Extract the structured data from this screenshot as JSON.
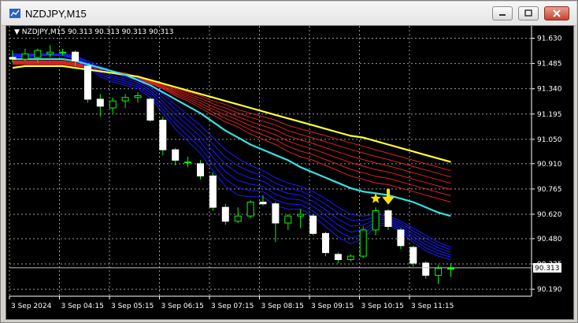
{
  "window": {
    "title": "NZDJPY,M15",
    "minimize_icon": "minimize-icon",
    "restore_icon": "restore-icon",
    "close_icon": "close-icon"
  },
  "chart_data": {
    "type": "candlestick",
    "symbol_header": "NZDJPY,M15  90.313 90.313 90.313 90.313",
    "ylim": [
      90.15,
      91.7
    ],
    "y_ticks": [
      "91.630",
      "91.485",
      "91.340",
      "91.195",
      "91.050",
      "90.910",
      "90.765",
      "90.620",
      "90.480",
      "90.335",
      "90.190"
    ],
    "y_tick_values": [
      91.63,
      91.485,
      91.34,
      91.195,
      91.05,
      90.91,
      90.765,
      90.62,
      90.48,
      90.335,
      90.19
    ],
    "x_ticks": [
      "3 Sep 2024",
      "3 Sep 04:15",
      "3 Sep 05:15",
      "3 Sep 06:15",
      "3 Sep 07:15",
      "3 Sep 08:15",
      "3 Sep 09:15",
      "3 Sep 10:15",
      "3 Sep 11:15"
    ],
    "current_price": "90.313",
    "grid": true,
    "colors": {
      "background": "#000000",
      "grid": "#9a9a9a",
      "bull_body": "#000000",
      "bull_outline": "#00ff00",
      "bear_body": "#ffffff",
      "bear_outline": "#ffffff",
      "wick": "#00ff00",
      "fast_ma": "#1a1aff",
      "cyan_ma": "#35e0e0",
      "yellow_ma": "#ffff33",
      "red_ma": "#dd2222",
      "annotation": "#ffe000"
    },
    "candles": [
      {
        "o": 91.52,
        "h": 91.56,
        "l": 91.49,
        "c": 91.51
      },
      {
        "o": 91.51,
        "h": 91.57,
        "l": 91.5,
        "c": 91.54
      },
      {
        "o": 91.52,
        "h": 91.57,
        "l": 91.49,
        "c": 91.56
      },
      {
        "o": 91.54,
        "h": 91.59,
        "l": 91.52,
        "c": 91.55
      },
      {
        "o": 91.55,
        "h": 91.57,
        "l": 91.53,
        "c": 91.55
      },
      {
        "o": 91.55,
        "h": 91.56,
        "l": 91.47,
        "c": 91.5
      },
      {
        "o": 91.47,
        "h": 91.48,
        "l": 91.26,
        "c": 91.28
      },
      {
        "o": 91.28,
        "h": 91.31,
        "l": 91.18,
        "c": 91.24
      },
      {
        "o": 91.23,
        "h": 91.29,
        "l": 91.2,
        "c": 91.27
      },
      {
        "o": 91.27,
        "h": 91.31,
        "l": 91.23,
        "c": 91.29
      },
      {
        "o": 91.29,
        "h": 91.32,
        "l": 91.26,
        "c": 91.3
      },
      {
        "o": 91.28,
        "h": 91.29,
        "l": 91.15,
        "c": 91.16
      },
      {
        "o": 91.16,
        "h": 91.18,
        "l": 90.96,
        "c": 90.99
      },
      {
        "o": 90.99,
        "h": 91.0,
        "l": 90.9,
        "c": 90.93
      },
      {
        "o": 90.92,
        "h": 90.95,
        "l": 90.89,
        "c": 90.92
      },
      {
        "o": 90.91,
        "h": 90.93,
        "l": 90.82,
        "c": 90.84
      },
      {
        "o": 90.84,
        "h": 90.86,
        "l": 90.64,
        "c": 90.66
      },
      {
        "o": 90.66,
        "h": 90.68,
        "l": 90.56,
        "c": 90.58
      },
      {
        "o": 90.58,
        "h": 90.66,
        "l": 90.57,
        "c": 90.61
      },
      {
        "o": 90.61,
        "h": 90.7,
        "l": 90.6,
        "c": 90.69
      },
      {
        "o": 90.69,
        "h": 90.73,
        "l": 90.67,
        "c": 90.68
      },
      {
        "o": 90.68,
        "h": 90.69,
        "l": 90.46,
        "c": 90.57
      },
      {
        "o": 90.57,
        "h": 90.62,
        "l": 90.53,
        "c": 90.61
      },
      {
        "o": 90.61,
        "h": 90.65,
        "l": 90.54,
        "c": 90.62
      },
      {
        "o": 90.61,
        "h": 90.62,
        "l": 90.5,
        "c": 90.51
      },
      {
        "o": 90.51,
        "h": 90.52,
        "l": 90.38,
        "c": 90.4
      },
      {
        "o": 90.39,
        "h": 90.4,
        "l": 90.34,
        "c": 90.36
      },
      {
        "o": 90.36,
        "h": 90.39,
        "l": 90.35,
        "c": 90.38
      },
      {
        "o": 90.38,
        "h": 90.55,
        "l": 90.37,
        "c": 90.53
      },
      {
        "o": 90.53,
        "h": 90.66,
        "l": 90.5,
        "c": 90.64
      },
      {
        "o": 90.64,
        "h": 90.65,
        "l": 90.53,
        "c": 90.55
      },
      {
        "o": 90.53,
        "h": 90.54,
        "l": 90.42,
        "c": 90.44
      },
      {
        "o": 90.43,
        "h": 90.44,
        "l": 90.32,
        "c": 90.34
      },
      {
        "o": 90.34,
        "h": 90.35,
        "l": 90.25,
        "c": 90.27
      },
      {
        "o": 90.27,
        "h": 90.33,
        "l": 90.22,
        "c": 90.31
      },
      {
        "o": 90.31,
        "h": 90.34,
        "l": 90.26,
        "c": 90.31
      }
    ],
    "ma_yellow": [
      91.46,
      91.47,
      91.47,
      91.47,
      91.47,
      91.46,
      91.45,
      91.44,
      91.43,
      91.42,
      91.41,
      91.39,
      91.37,
      91.35,
      91.33,
      91.31,
      91.29,
      91.27,
      91.25,
      91.23,
      91.21,
      91.19,
      91.17,
      91.15,
      91.13,
      91.11,
      91.09,
      91.07,
      91.06,
      91.04,
      91.02,
      91.0,
      90.98,
      90.96,
      90.94,
      90.92
    ],
    "ma_red_top": [
      91.48,
      91.48,
      91.48,
      91.48,
      91.48,
      91.47,
      91.46,
      91.45,
      91.44,
      91.43,
      91.41,
      91.39,
      91.37,
      91.34,
      91.32,
      91.3,
      91.27,
      91.25,
      91.22,
      91.2,
      91.18,
      91.16,
      91.13,
      91.11,
      91.09,
      91.07,
      91.05,
      91.03,
      91.01,
      90.99,
      90.97,
      90.95,
      90.93,
      90.91,
      90.89,
      90.87
    ],
    "ma_red_bottom": [
      91.5,
      91.5,
      91.5,
      91.5,
      91.5,
      91.49,
      91.47,
      91.46,
      91.44,
      91.42,
      91.4,
      91.37,
      91.34,
      91.3,
      91.27,
      91.23,
      91.19,
      91.15,
      91.12,
      91.08,
      91.05,
      91.02,
      90.98,
      90.95,
      90.93,
      90.9,
      90.87,
      90.84,
      90.82,
      90.8,
      90.79,
      90.77,
      90.75,
      90.73,
      90.71,
      90.69
    ],
    "ma_cyan": [
      91.51,
      91.51,
      91.51,
      91.51,
      91.51,
      91.5,
      91.48,
      91.46,
      91.44,
      91.42,
      91.39,
      91.36,
      91.32,
      91.28,
      91.24,
      91.2,
      91.15,
      91.1,
      91.06,
      91.02,
      90.99,
      90.96,
      90.93,
      90.89,
      90.86,
      90.83,
      90.8,
      90.77,
      90.75,
      90.74,
      90.73,
      90.71,
      90.69,
      90.66,
      90.63,
      90.61
    ],
    "ma_blue_top": [
      91.52,
      91.52,
      91.53,
      91.53,
      91.53,
      91.51,
      91.46,
      91.41,
      91.38,
      91.36,
      91.34,
      91.29,
      91.2,
      91.11,
      91.04,
      90.97,
      90.87,
      90.78,
      90.73,
      90.72,
      90.72,
      90.67,
      90.65,
      90.65,
      90.61,
      90.55,
      90.49,
      90.45,
      90.48,
      90.55,
      90.56,
      90.52,
      90.46,
      90.41,
      90.38,
      90.36
    ],
    "ma_blue_bottom": [
      91.54,
      91.54,
      91.54,
      91.54,
      91.54,
      91.53,
      91.5,
      91.47,
      91.44,
      91.42,
      91.4,
      91.36,
      91.31,
      91.25,
      91.19,
      91.13,
      91.06,
      90.99,
      90.94,
      90.9,
      90.87,
      90.83,
      90.8,
      90.78,
      90.75,
      90.71,
      90.66,
      90.62,
      90.61,
      90.62,
      90.61,
      90.58,
      90.54,
      90.5,
      90.46,
      90.43
    ],
    "annotations": [
      {
        "type": "star",
        "index": 29,
        "price": 90.71,
        "name": "star-icon"
      },
      {
        "type": "arrow-down",
        "index": 30,
        "price": 90.73,
        "name": "arrow-down-icon"
      }
    ]
  }
}
